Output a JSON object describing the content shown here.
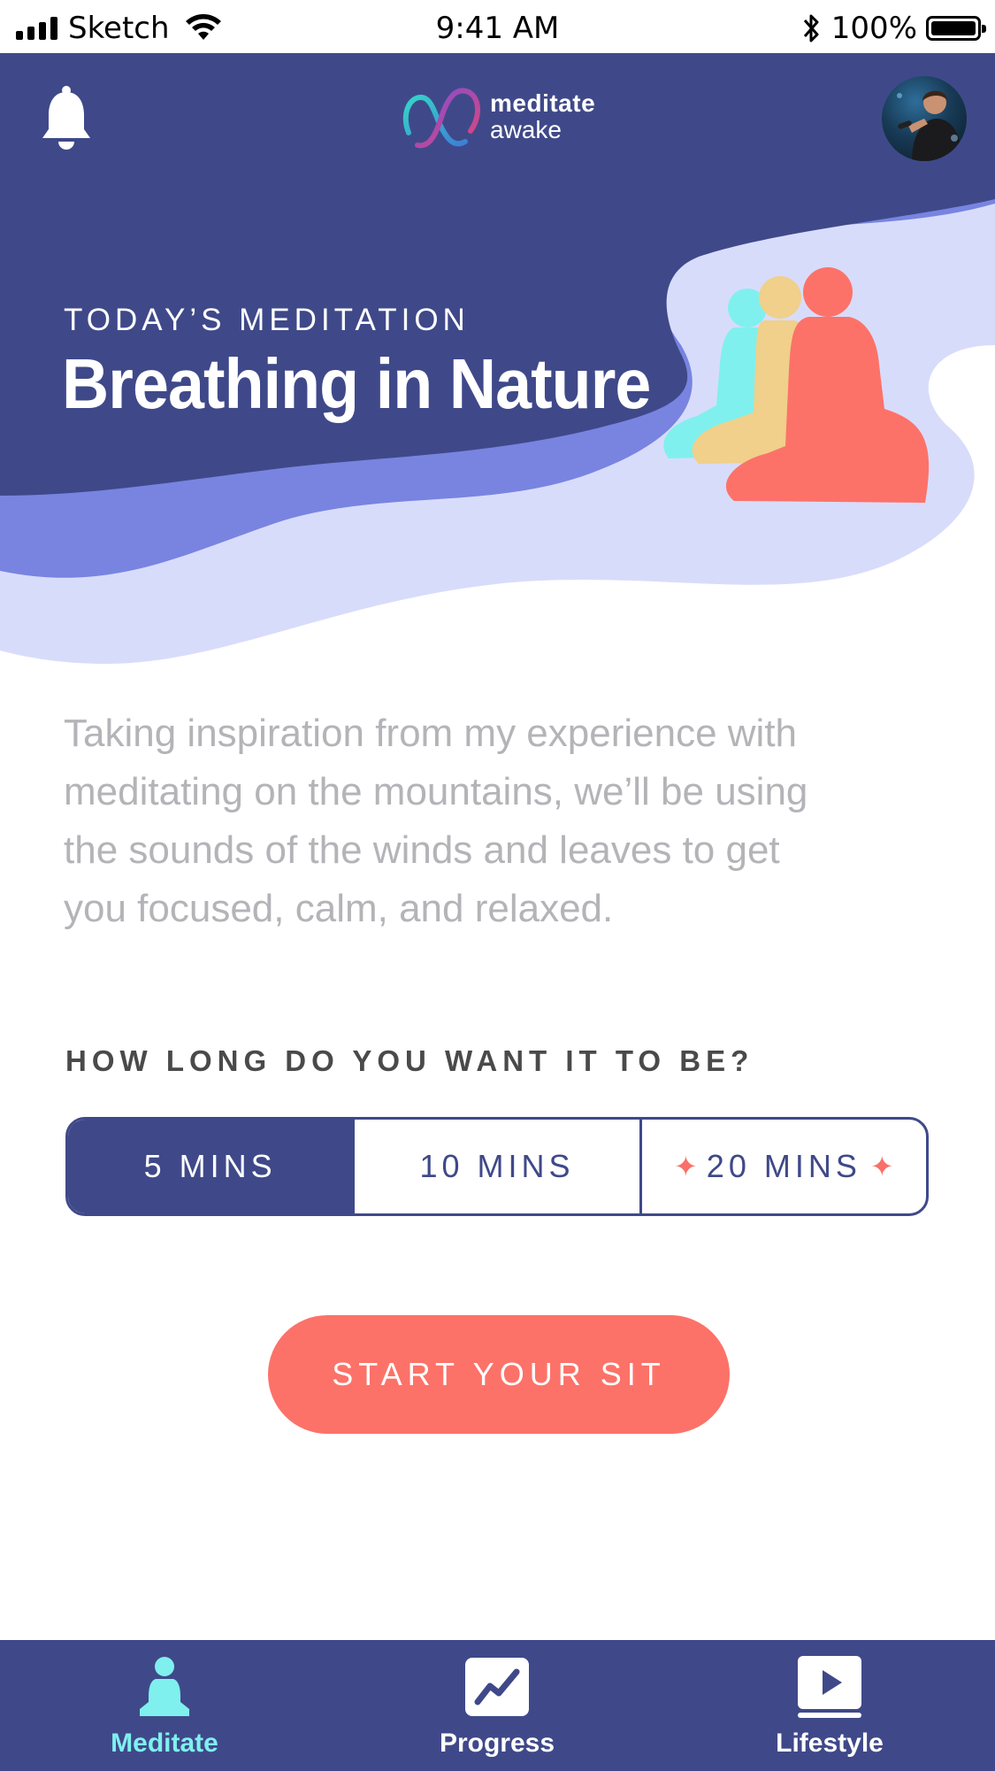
{
  "status_bar": {
    "carrier": "Sketch",
    "time": "9:41 AM",
    "battery": "100%"
  },
  "header": {
    "logo_line1": "meditate",
    "logo_line2": "awake"
  },
  "hero": {
    "label": "TODAY’S MEDITATION",
    "title": "Breathing in Nature"
  },
  "description": {
    "lines": [
      "Taking inspiration from my experience with",
      "meditating on the mountains, we’ll be using",
      "the sounds of the winds and leaves to get",
      "you focused, calm, and relaxed."
    ]
  },
  "duration": {
    "question": "HOW LONG DO YOU WANT IT TO BE?",
    "options": [
      "5 MINS",
      "10 MINS",
      "20 MINS"
    ],
    "selected": "5 MINS"
  },
  "cta": {
    "label": "START YOUR SIT"
  },
  "tabs": [
    {
      "label": "Meditate",
      "active": true,
      "icon": "meditate-icon"
    },
    {
      "label": "Progress",
      "active": false,
      "icon": "progress-chart-icon"
    },
    {
      "label": "Lifestyle",
      "active": false,
      "icon": "play-video-icon"
    }
  ],
  "colors": {
    "primary": "#3f4989",
    "wave_mid": "#7884e0",
    "wave_light": "#d8dcfb",
    "accent_coral": "#fc7268",
    "accent_sand": "#f0d08a",
    "accent_aqua": "#7ff0ee",
    "description_text": "#b4b4b8"
  }
}
